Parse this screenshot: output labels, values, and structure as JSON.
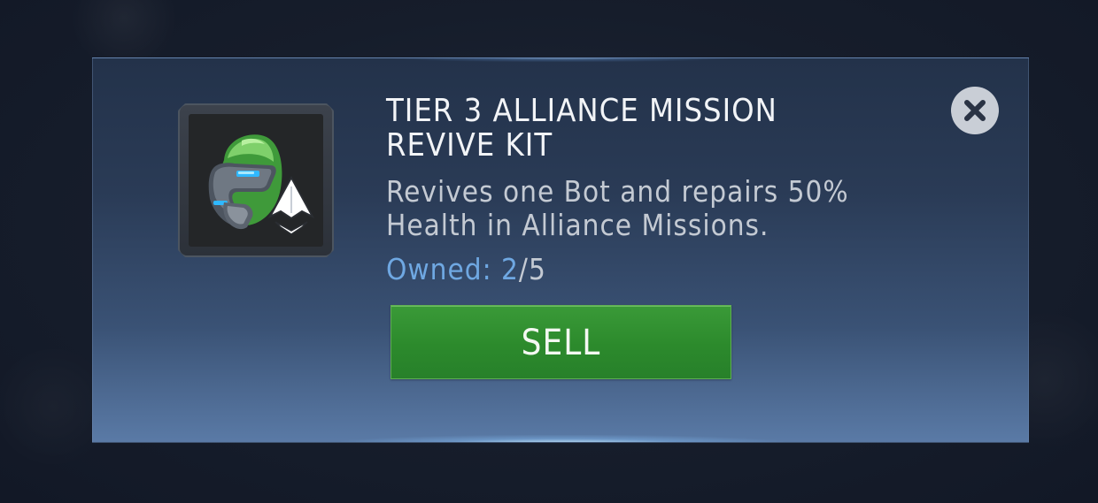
{
  "dialog": {
    "title": "TIER 3 ALLIANCE MISSION REVIVE KIT",
    "description": "Revives one Bot and repairs 50% Health in Alliance Missions.",
    "owned": {
      "label": "Owned: ",
      "count": "2",
      "separator": "/",
      "max": "5"
    },
    "sell_label": "SELL",
    "close_icon": "close-icon",
    "item_icon": "revive-kit-helmet-icon"
  },
  "colors": {
    "title": "#f2f4f7",
    "description": "#c4cad3",
    "owned_accent": "#6fa8e2",
    "sell_button": "#2e8c2e",
    "panel_top": "#23324a",
    "panel_bottom": "#5a7aa6"
  }
}
